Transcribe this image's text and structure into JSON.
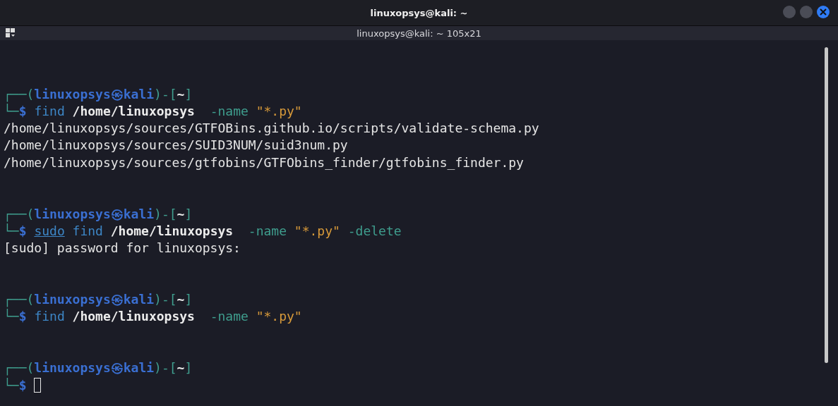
{
  "window": {
    "title": "linuxopsys@kali: ~"
  },
  "tab": {
    "title": "linuxopsys@kali: ~ 105x21"
  },
  "terminal": {
    "lines": [
      {
        "kind": "blank"
      },
      {
        "kind": "blank"
      },
      {
        "kind": "text",
        "segments": [
          {
            "kind": "frame",
            "text": "┌──("
          },
          {
            "kind": "user",
            "text": "linuxopsys㉿kali"
          },
          {
            "kind": "frame",
            "text": ")-["
          },
          {
            "kind": "dir",
            "text": "~"
          },
          {
            "kind": "frame",
            "text": "]"
          }
        ]
      },
      {
        "kind": "text",
        "segments": [
          {
            "kind": "frame",
            "text": "└─"
          },
          {
            "kind": "user",
            "text": "$ "
          },
          {
            "kind": "cmd",
            "text": "find "
          },
          {
            "kind": "path",
            "text": "/home/linuxopsys"
          },
          {
            "kind": "arg",
            "text": "  -name "
          },
          {
            "kind": "string",
            "text": "\"*.py\""
          }
        ]
      },
      {
        "kind": "text",
        "segments": [
          {
            "kind": "output",
            "text": "/home/linuxopsys/sources/GTFOBins.github.io/scripts/validate-schema.py"
          }
        ]
      },
      {
        "kind": "text",
        "segments": [
          {
            "kind": "output",
            "text": "/home/linuxopsys/sources/SUID3NUM/suid3num.py"
          }
        ]
      },
      {
        "kind": "text",
        "segments": [
          {
            "kind": "output",
            "text": "/home/linuxopsys/sources/gtfobins/GTFObins_finder/gtfobins_finder.py"
          }
        ]
      },
      {
        "kind": "blank"
      },
      {
        "kind": "blank"
      },
      {
        "kind": "text",
        "segments": [
          {
            "kind": "frame",
            "text": "┌──("
          },
          {
            "kind": "user",
            "text": "linuxopsys㉿kali"
          },
          {
            "kind": "frame",
            "text": ")-["
          },
          {
            "kind": "dir",
            "text": "~"
          },
          {
            "kind": "frame",
            "text": "]"
          }
        ]
      },
      {
        "kind": "text",
        "segments": [
          {
            "kind": "frame",
            "text": "└─"
          },
          {
            "kind": "user",
            "text": "$ "
          },
          {
            "kind": "sudo",
            "text": "sudo"
          },
          {
            "kind": "cmd",
            "text": " find "
          },
          {
            "kind": "path",
            "text": "/home/linuxopsys"
          },
          {
            "kind": "arg",
            "text": "  -name "
          },
          {
            "kind": "string",
            "text": "\"*.py\""
          },
          {
            "kind": "arg",
            "text": " -delete"
          }
        ]
      },
      {
        "kind": "text",
        "segments": [
          {
            "kind": "output",
            "text": "[sudo] password for linuxopsys:"
          }
        ]
      },
      {
        "kind": "blank"
      },
      {
        "kind": "blank"
      },
      {
        "kind": "text",
        "segments": [
          {
            "kind": "frame",
            "text": "┌──("
          },
          {
            "kind": "user",
            "text": "linuxopsys㉿kali"
          },
          {
            "kind": "frame",
            "text": ")-["
          },
          {
            "kind": "dir",
            "text": "~"
          },
          {
            "kind": "frame",
            "text": "]"
          }
        ]
      },
      {
        "kind": "text",
        "segments": [
          {
            "kind": "frame",
            "text": "└─"
          },
          {
            "kind": "user",
            "text": "$ "
          },
          {
            "kind": "cmd",
            "text": "find "
          },
          {
            "kind": "path",
            "text": "/home/linuxopsys"
          },
          {
            "kind": "arg",
            "text": "  -name "
          },
          {
            "kind": "string",
            "text": "\"*.py\""
          }
        ]
      },
      {
        "kind": "blank"
      },
      {
        "kind": "blank"
      },
      {
        "kind": "text",
        "segments": [
          {
            "kind": "frame",
            "text": "┌──("
          },
          {
            "kind": "user",
            "text": "linuxopsys㉿kali"
          },
          {
            "kind": "frame",
            "text": ")-["
          },
          {
            "kind": "dir",
            "text": "~"
          },
          {
            "kind": "frame",
            "text": "]"
          }
        ]
      },
      {
        "kind": "text",
        "cursor": true,
        "segments": [
          {
            "kind": "frame",
            "text": "└─"
          },
          {
            "kind": "user",
            "text": "$ "
          }
        ]
      }
    ]
  }
}
